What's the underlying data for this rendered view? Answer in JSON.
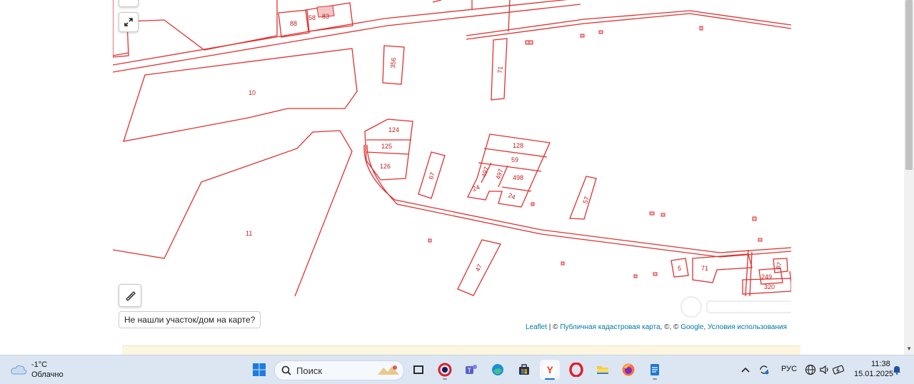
{
  "map": {
    "parcels": [
      {
        "id": "88",
        "label": "88"
      },
      {
        "id": "58",
        "label": "58"
      },
      {
        "id": "83",
        "label": "83"
      },
      {
        "id": "356",
        "label": "356"
      },
      {
        "id": "71a",
        "label": "71"
      },
      {
        "id": "10",
        "label": "10"
      },
      {
        "id": "124",
        "label": "124"
      },
      {
        "id": "125",
        "label": "125"
      },
      {
        "id": "126",
        "label": "126"
      },
      {
        "id": "67",
        "label": "67"
      },
      {
        "id": "128",
        "label": "128"
      },
      {
        "id": "59",
        "label": "59"
      },
      {
        "id": "497a",
        "label": "497"
      },
      {
        "id": "497b",
        "label": "497"
      },
      {
        "id": "498",
        "label": "498"
      },
      {
        "id": "24a",
        "label": "24"
      },
      {
        "id": "24b",
        "label": "24"
      },
      {
        "id": "57",
        "label": "57"
      },
      {
        "id": "11",
        "label": "11"
      },
      {
        "id": "47",
        "label": "47"
      },
      {
        "id": "5",
        "label": "5"
      },
      {
        "id": "71b",
        "label": "71"
      },
      {
        "id": "249",
        "label": "249"
      },
      {
        "id": "87",
        "label": "87"
      },
      {
        "id": "320",
        "label": "320"
      }
    ],
    "not_found_label": "Не нашли участок/дом на карте?",
    "attribution": {
      "leaflet": "Leaflet",
      "sep1": " | © ",
      "cadastral": "Публичная кадастровая карта",
      "sep2": ", ©, © ",
      "google": "Google",
      "sep3": ", ",
      "terms": "Условия использования"
    },
    "colors": {
      "boundary": "#e0312f",
      "label": "#c21f1f",
      "link": "#0078a8"
    }
  },
  "taskbar": {
    "weather": {
      "temp": "-1°C",
      "condition": "Облачно",
      "icon": "cloud-icon"
    },
    "search_placeholder": "Поиск",
    "apps": [
      {
        "name": "start",
        "icon": "windows-start-icon"
      },
      {
        "name": "task-view",
        "icon": "task-view-icon"
      },
      {
        "name": "ccleaner",
        "icon": "ccleaner-icon"
      },
      {
        "name": "teams",
        "icon": "teams-icon"
      },
      {
        "name": "edge",
        "icon": "edge-icon"
      },
      {
        "name": "store",
        "icon": "store-icon"
      },
      {
        "name": "yandex-browser",
        "icon": "yandex-icon"
      },
      {
        "name": "opera",
        "icon": "opera-icon"
      },
      {
        "name": "file-explorer",
        "icon": "folder-icon"
      },
      {
        "name": "firefox",
        "icon": "firefox-icon"
      },
      {
        "name": "notepad",
        "icon": "notepad-icon"
      }
    ],
    "tray": {
      "language": "РУС",
      "time": "11:38",
      "date": "15.01.2025"
    }
  }
}
